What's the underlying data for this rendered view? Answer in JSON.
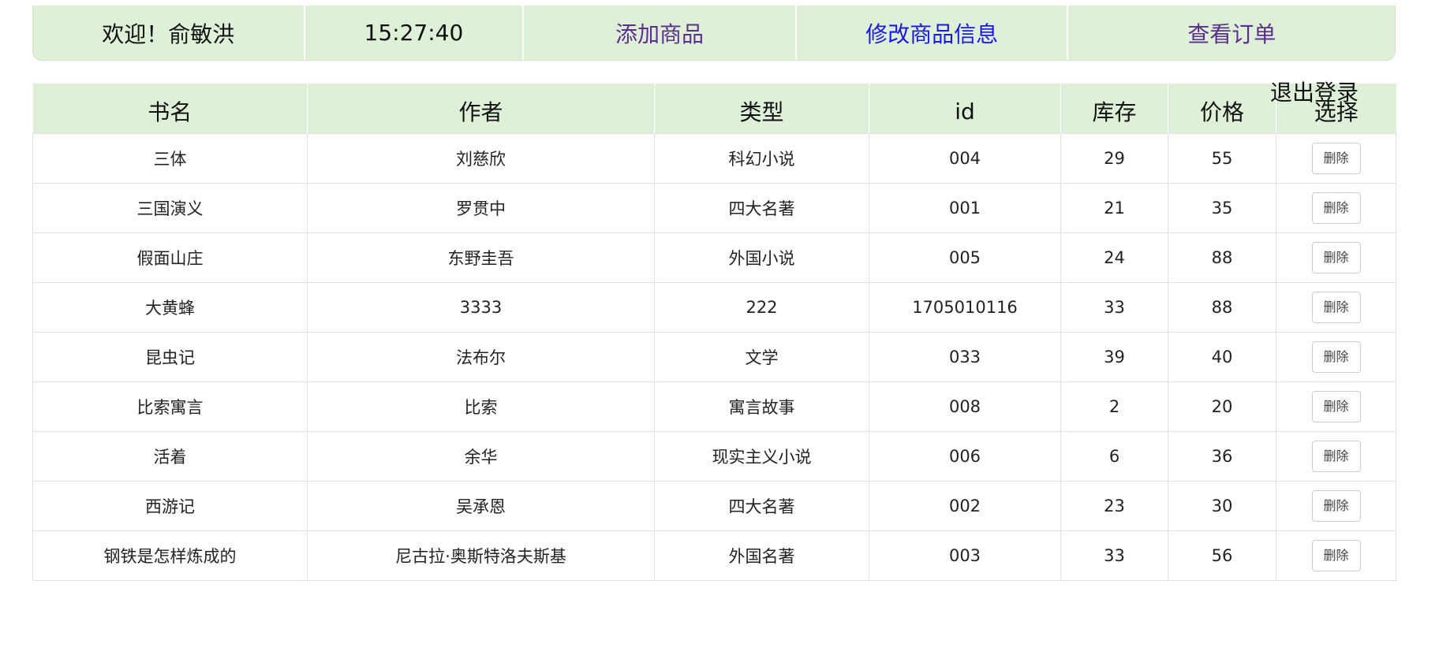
{
  "header": {
    "welcome": "欢迎！俞敏洪",
    "clock": "15:27:40",
    "nav": {
      "add_product": "添加商品",
      "edit_product": "修改商品信息",
      "view_orders": "查看订单"
    },
    "logout": "退出登录"
  },
  "colors": {
    "header_bg": "#dff0d8",
    "link_visited": "#5b2f8c",
    "link_active": "#1a1adf"
  },
  "table": {
    "columns": [
      "书名",
      "作者",
      "类型",
      "id",
      "库存",
      "价格",
      "选择"
    ],
    "delete_label": "删除",
    "rows": [
      [
        "三体",
        "刘慈欣",
        "科幻小说",
        "004",
        "29",
        "55"
      ],
      [
        "三国演义",
        "罗贯中",
        "四大名著",
        "001",
        "21",
        "35"
      ],
      [
        "假面山庄",
        "东野圭吾",
        "外国小说",
        "005",
        "24",
        "88"
      ],
      [
        "大黄蜂",
        "3333",
        "222",
        "1705010116",
        "33",
        "88"
      ],
      [
        "昆虫记",
        "法布尔",
        "文学",
        "033",
        "39",
        "40"
      ],
      [
        "比索寓言",
        "比索",
        "寓言故事",
        "008",
        "2",
        "20"
      ],
      [
        "活着",
        "余华",
        "现实主义小说",
        "006",
        "6",
        "36"
      ],
      [
        "西游记",
        "吴承恩",
        "四大名著",
        "002",
        "23",
        "30"
      ],
      [
        "钢铁是怎样炼成的",
        "尼古拉·奥斯特洛夫斯基",
        "外国名著",
        "003",
        "33",
        "56"
      ]
    ]
  }
}
